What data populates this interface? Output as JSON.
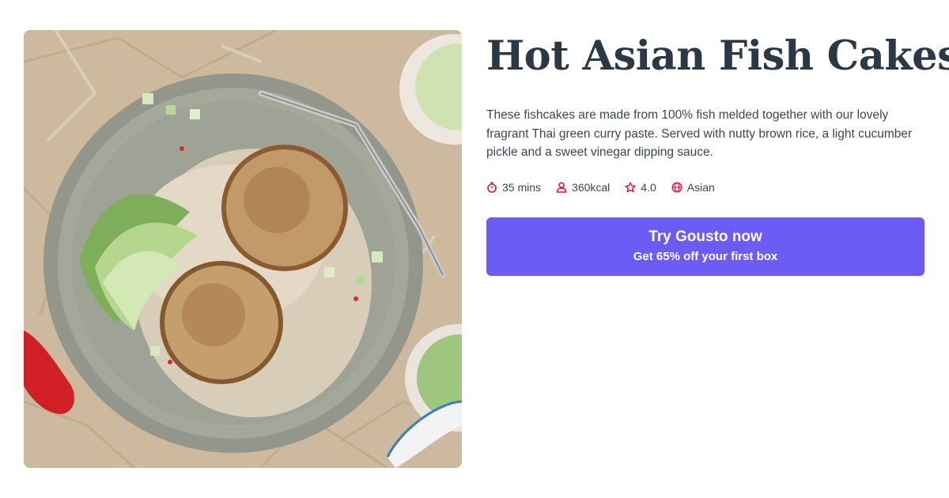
{
  "recipe": {
    "title": "Hot Asian Fish Cakes",
    "description": "These fishcakes are made from 100% fish melded together with our lovely fragrant Thai green curry paste. Served with nutty brown rice, a light cucumber pickle and a sweet vinegar dipping sauce.",
    "meta": {
      "time": "35 mins",
      "calories": "360kcal",
      "rating": "4.0",
      "cuisine": "Asian"
    }
  },
  "cta": {
    "main_label": "Try Gousto now",
    "sub_label": "Get 65% off your first box"
  },
  "icons": {
    "time": "stopwatch-icon",
    "calories": "person-icon",
    "rating": "star-icon",
    "cuisine": "globe-icon"
  },
  "colors": {
    "accent_icon": "#e0143c",
    "cta_background": "#6b5cf6",
    "title": "#2b3846",
    "body_text": "#3b4654"
  }
}
